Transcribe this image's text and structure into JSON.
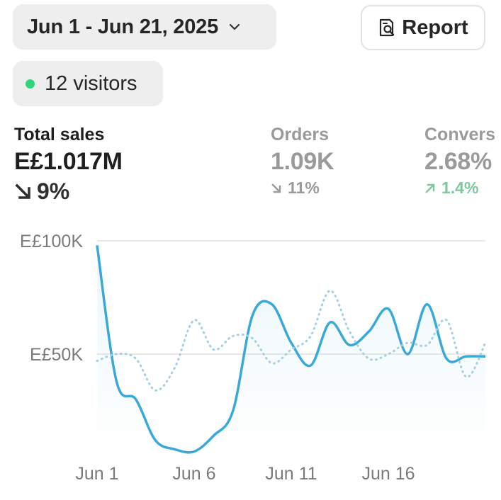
{
  "header": {
    "date_range": "Jun 1 - Jun 21, 2025",
    "report_label": "Report",
    "visitors_label": "12 visitors"
  },
  "metrics": [
    {
      "label": "Total sales",
      "value": "E£1.017M",
      "delta": "9%",
      "direction": "down"
    },
    {
      "label": "Orders",
      "value": "1.09K",
      "delta": "11%",
      "direction": "down"
    },
    {
      "label": "Convers",
      "value": "2.68%",
      "delta": "1.4%",
      "direction": "up"
    }
  ],
  "colors": {
    "line": "#3aa9d9",
    "dotted": "#a3d0e3",
    "live_dot": "#35d27b",
    "positive": "#7fc79e"
  },
  "chart_data": {
    "type": "line",
    "ylim": [
      0,
      100000
    ],
    "yticks": [
      {
        "value": 100000,
        "label": "E£100K"
      },
      {
        "value": 50000,
        "label": "E£50K"
      }
    ],
    "x": [
      1,
      2,
      3,
      4,
      5,
      6,
      7,
      8,
      9,
      10,
      11,
      12,
      13,
      14,
      15,
      16,
      17,
      18,
      19,
      20,
      21
    ],
    "xtick_labels": [
      "Jun 1",
      "Jun 6",
      "Jun 11",
      "Jun 16"
    ],
    "xtick_positions": [
      1,
      6,
      11,
      16
    ],
    "series": [
      {
        "style": "solid",
        "values": [
          98000,
          38000,
          30000,
          12000,
          8000,
          7000,
          14000,
          25000,
          67000,
          72000,
          55000,
          45000,
          64000,
          54000,
          60000,
          70000,
          50000,
          72000,
          48000,
          49000,
          49000
        ]
      },
      {
        "style": "dotted",
        "values": [
          47000,
          50000,
          48000,
          34000,
          44000,
          65000,
          52000,
          58000,
          57000,
          46000,
          52000,
          58000,
          78000,
          60000,
          48000,
          50000,
          55000,
          54000,
          65000,
          40000,
          55000
        ]
      }
    ]
  }
}
